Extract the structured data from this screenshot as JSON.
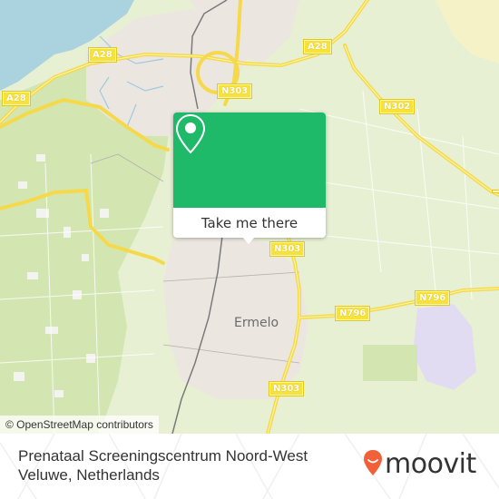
{
  "map": {
    "road_shields": [
      {
        "label": "A28",
        "id": "a28-north"
      },
      {
        "label": "A28",
        "id": "a28-west"
      },
      {
        "label": "A28",
        "id": "a28-east"
      },
      {
        "label": "N303",
        "id": "n303-north"
      },
      {
        "label": "N302",
        "id": "n302"
      },
      {
        "label": "N303",
        "id": "n303-center"
      },
      {
        "label": "N796",
        "id": "n796-west"
      },
      {
        "label": "N796",
        "id": "n796-east"
      },
      {
        "label": "N303",
        "id": "n303-south"
      }
    ],
    "place_label": "Ermelo",
    "attribution": "© OpenStreetMap contributors",
    "colors": {
      "water": "#aad3df",
      "forest": "#d5e8b5",
      "urban": "#ece7e3",
      "road": "#f7e23b"
    }
  },
  "popup": {
    "icon": "map-pin-icon",
    "button_label": "Take me there",
    "color": "#1fb96a"
  },
  "footer": {
    "title": "Prenataal Screeningscentrum Noord-West Veluwe, Netherlands",
    "brand": "moovit",
    "brand_color": "#f2603a"
  }
}
